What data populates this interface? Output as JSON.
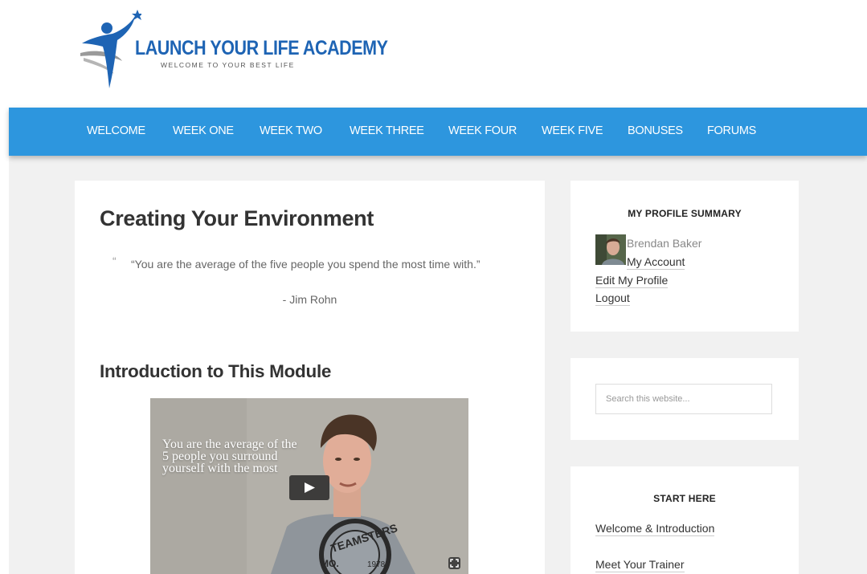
{
  "brand": {
    "title": "LAUNCH YOUR LIFE ACADEMY",
    "tagline": "WELCOME TO YOUR BEST LIFE",
    "color": "#1e64b4"
  },
  "nav": {
    "color": "#2d96de",
    "items": [
      {
        "label": "WELCOME"
      },
      {
        "label": "WEEK ONE"
      },
      {
        "label": "WEEK TWO"
      },
      {
        "label": "WEEK THREE"
      },
      {
        "label": "WEEK FOUR"
      },
      {
        "label": "WEEK FIVE"
      },
      {
        "label": "BONUSES"
      },
      {
        "label": "FORUMS"
      }
    ]
  },
  "main": {
    "title": "Creating Your Environment",
    "quote": {
      "text": "“You are the average of the five people you spend the most time with.”",
      "author": "- Jim Rohn"
    },
    "section_title": "Introduction to This Module",
    "video": {
      "overlay_text": "You are the average of the 5 people you surround yourself with the most",
      "shirt_text": "TEAMSTERS",
      "shirt_year": "1978",
      "shirt_abbrev": "MO."
    }
  },
  "sidebar": {
    "profile": {
      "title": "MY PROFILE SUMMARY",
      "name": "Brendan Baker",
      "links": [
        "My Account",
        "Edit My Profile",
        "Logout"
      ]
    },
    "search": {
      "placeholder": "Search this website..."
    },
    "start_here": {
      "title": "START HERE",
      "links": [
        "Welcome & Introduction",
        "Meet Your Trainer"
      ]
    }
  }
}
